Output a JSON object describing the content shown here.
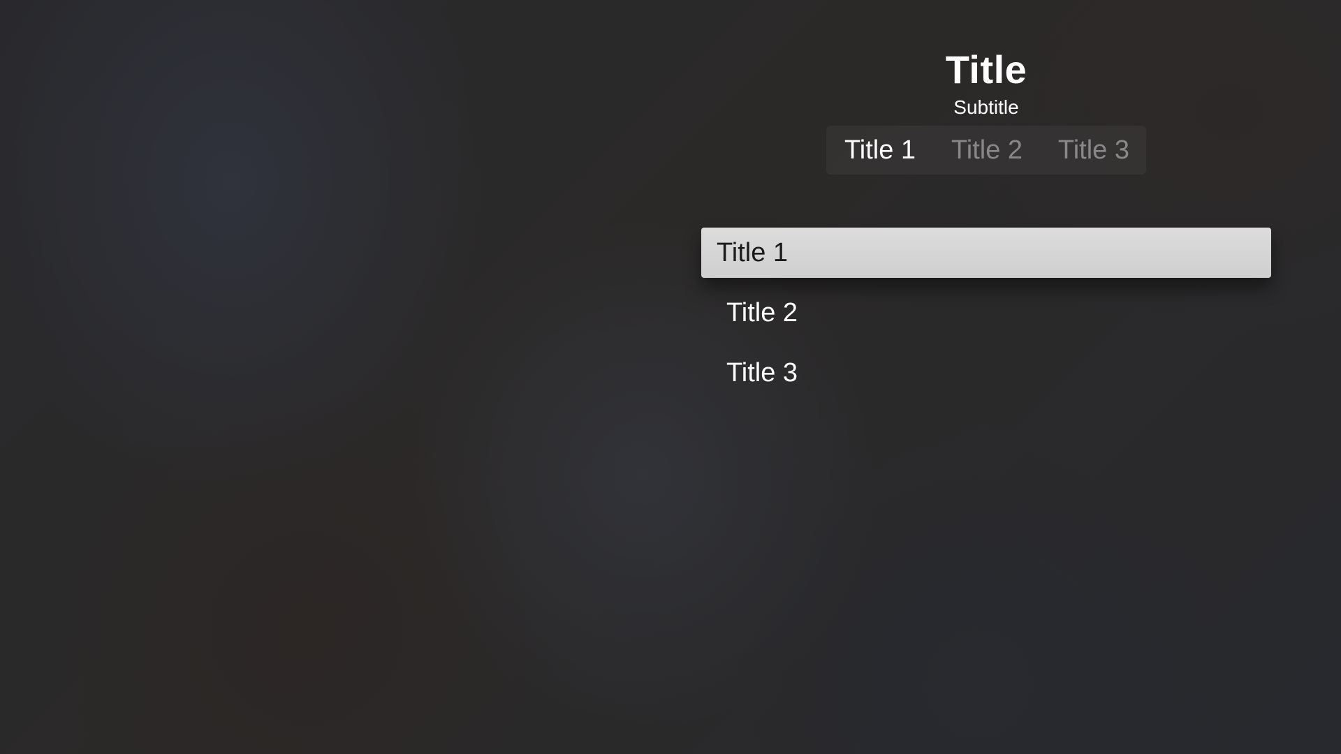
{
  "header": {
    "title": "Title",
    "subtitle": "Subtitle"
  },
  "segmented_control": {
    "selected_index": 0,
    "segments": [
      {
        "label": "Title 1"
      },
      {
        "label": "Title 2"
      },
      {
        "label": "Title 3"
      }
    ]
  },
  "list": {
    "focused_index": 0,
    "items": [
      {
        "label": "Title 1"
      },
      {
        "label": "Title 2"
      },
      {
        "label": "Title 3"
      }
    ]
  },
  "colors": {
    "focused_row_background": "#d6d6d6",
    "focused_row_text": "#1a1a1a",
    "text": "#ffffff",
    "inactive_segment_text": "#8a8a8a"
  }
}
